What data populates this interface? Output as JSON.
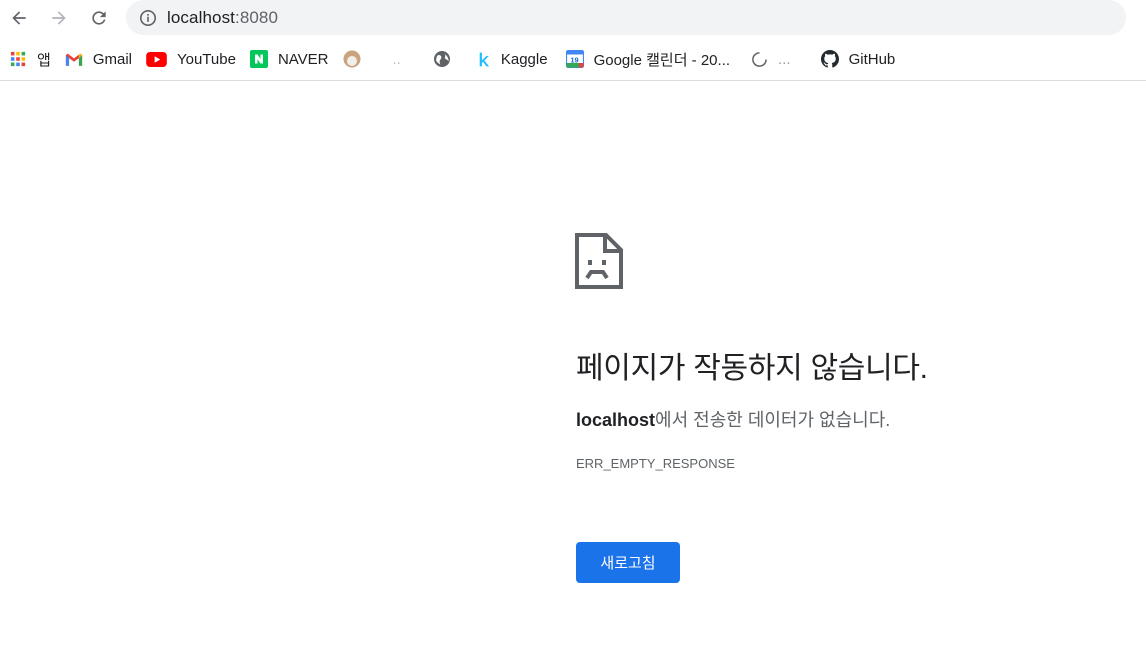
{
  "toolbar": {
    "back_icon": "arrow-left-icon",
    "forward_icon": "arrow-right-icon",
    "reload_icon": "reload-icon",
    "omnibox": {
      "security_icon": "info-circle-icon",
      "host": "localhost",
      "port": ":8080"
    }
  },
  "bookmarks": [
    {
      "label": "앱",
      "icon": "apps-grid-icon"
    },
    {
      "label": "Gmail",
      "icon": "gmail-icon"
    },
    {
      "label": "YouTube",
      "icon": "youtube-icon"
    },
    {
      "label": "NAVER",
      "icon": "naver-icon"
    },
    {
      "label": "..",
      "icon": "avatar-icon"
    },
    {
      "label": "",
      "icon": "globe-icon"
    },
    {
      "label": "Kaggle",
      "icon": "kaggle-icon"
    },
    {
      "label": "Google 캘린더 - 20...",
      "icon": "calendar-icon"
    },
    {
      "label": "...",
      "icon": "loading-icon"
    },
    {
      "label": "GitHub",
      "icon": "github-icon"
    }
  ],
  "error": {
    "icon": "sad-page-icon",
    "title": "페이지가 작동하지 않습니다.",
    "host": "localhost",
    "description_suffix": "에서 전송한 데이터가 없습니다.",
    "code": "ERR_EMPTY_RESPONSE",
    "reload_label": "새로고침"
  },
  "colors": {
    "accent": "#1a73e8",
    "omnibox_bg": "#f1f3f4",
    "text_primary": "#202124",
    "text_secondary": "#5f6368"
  }
}
